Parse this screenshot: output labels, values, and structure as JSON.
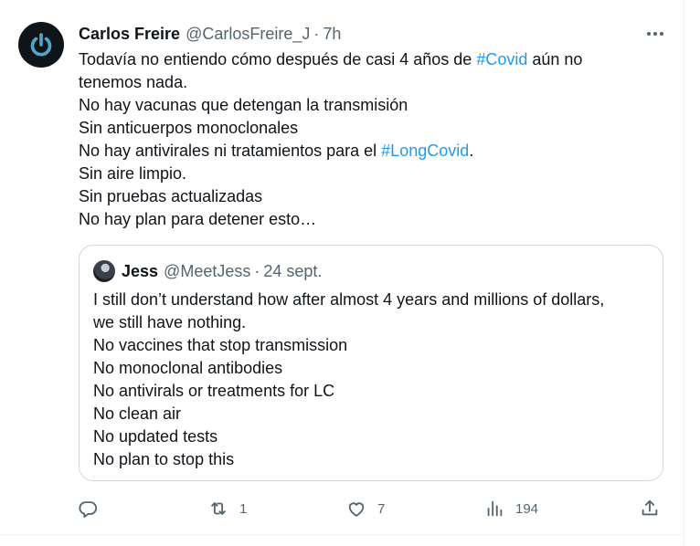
{
  "tweet": {
    "author_name": "Carlos Freire",
    "author_handle": "@CarlosFreire_J",
    "separator": "·",
    "time": "7h",
    "lines": [
      {
        "parts": [
          {
            "text": "Todavía no entiendo cómo después de casi 4 años de "
          },
          {
            "text": "#Covid",
            "hashtag": true
          },
          {
            "text": " aún no"
          }
        ]
      },
      {
        "parts": [
          {
            "text": "tenemos nada."
          }
        ]
      },
      {
        "parts": [
          {
            "text": "No hay vacunas que detengan la transmisión"
          }
        ]
      },
      {
        "parts": [
          {
            "text": "Sin anticuerpos monoclonales"
          }
        ]
      },
      {
        "parts": [
          {
            "text": "No hay antivirales ni tratamientos para el "
          },
          {
            "text": "#LongCovid",
            "hashtag": true
          },
          {
            "text": "."
          }
        ]
      },
      {
        "parts": [
          {
            "text": "Sin aire limpio."
          }
        ]
      },
      {
        "parts": [
          {
            "text": "Sin pruebas actualizadas"
          }
        ]
      },
      {
        "parts": [
          {
            "text": "No hay plan para detener esto…"
          }
        ]
      }
    ]
  },
  "quote": {
    "author_name": "Jess",
    "author_handle": "@MeetJess",
    "separator": "·",
    "date": "24 sept.",
    "lines": [
      "I still don’t understand how after almost 4 years and millions of dollars,",
      "we still have nothing.",
      "No vaccines that stop transmission",
      "No monoclonal antibodies",
      "No antivirals or treatments for LC",
      "No clean air",
      "No updated tests",
      "No plan to stop this"
    ]
  },
  "actions": {
    "reply_count": "",
    "retweet_count": "1",
    "like_count": "7",
    "views_count": "194"
  },
  "colors": {
    "text": "#0f1419",
    "secondary": "#536471",
    "hashtag": "#1d9bf0",
    "border": "#cfd9de",
    "avatar_ring": "#4fa8c8"
  },
  "icons": [
    "power-icon",
    "more-icon",
    "reply-icon",
    "retweet-icon",
    "like-icon",
    "views-icon",
    "share-icon"
  ]
}
